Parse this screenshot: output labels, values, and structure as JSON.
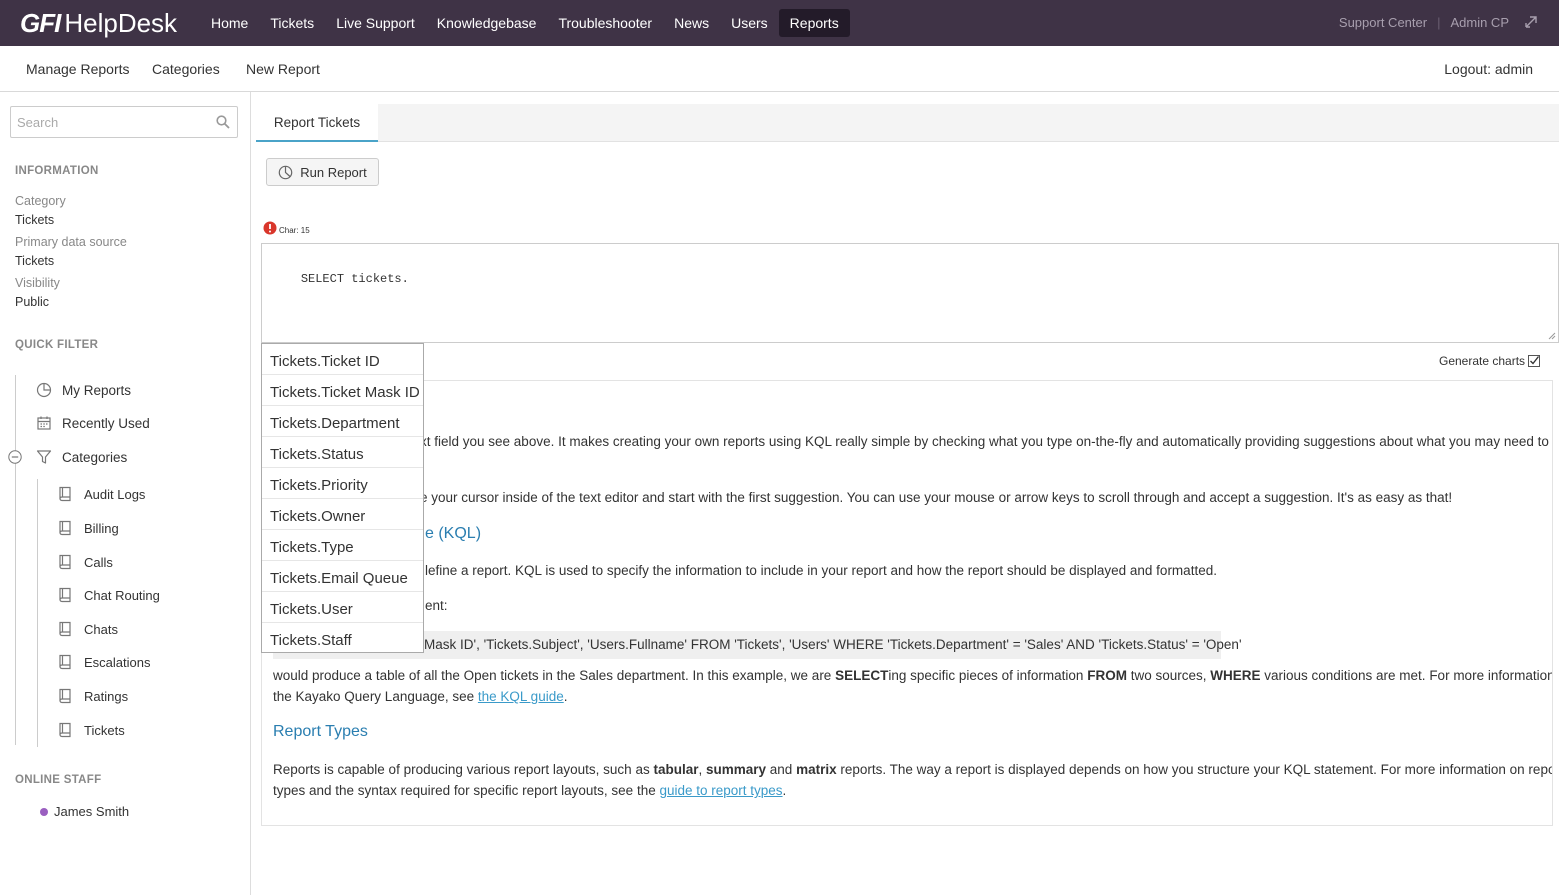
{
  "topbar": {
    "logo_brand": "GFI",
    "logo_product": "HelpDesk",
    "nav": [
      "Home",
      "Tickets",
      "Live Support",
      "Knowledgebase",
      "Troubleshooter",
      "News",
      "Users",
      "Reports"
    ],
    "active_nav": "Reports",
    "links": {
      "support_center": "Support Center",
      "admin_cp": "Admin CP"
    }
  },
  "subnav": {
    "items": [
      "Manage Reports",
      "Categories",
      "New Report"
    ],
    "logout": "Logout: admin"
  },
  "sidebar": {
    "search_placeholder": "Search",
    "information_heading": "INFORMATION",
    "info": [
      {
        "label": "Category",
        "value": "Tickets"
      },
      {
        "label": "Primary data source",
        "value": "Tickets"
      },
      {
        "label": "Visibility",
        "value": "Public"
      }
    ],
    "quick_filter_heading": "QUICK FILTER",
    "quick_filters": [
      "My Reports",
      "Recently Used",
      "Categories"
    ],
    "categories": [
      "Audit Logs",
      "Billing",
      "Calls",
      "Chat Routing",
      "Chats",
      "Escalations",
      "Ratings",
      "Tickets"
    ],
    "online_staff_heading": "ONLINE STAFF",
    "staff": [
      {
        "name": "James Smith",
        "status_color": "#9a5fc0"
      }
    ]
  },
  "main": {
    "tab": "Report Tickets",
    "run_report": "Run Report",
    "char_info": "Char: 15",
    "editor_value": "SELECT tickets.",
    "generate_charts": "Generate charts",
    "generate_charts_checked": true,
    "help": {
      "p1_visible": "xt field you see above. It makes creating your own reports using KQL really simple by checking what you type on-the-fly and automatically providing suggestions about what you may need to",
      "p2_visible": "e your cursor inside of the text editor and start with the first suggestion. You can use your mouse or arrow keys to scroll through and accept a suggestion. It's as easy as that!",
      "heading1_visible": "e (KQL)",
      "p3_visible": "lefine a report. KQL is used to specify the information to include in your report and how the report should be displayed and formatted.",
      "p4_visible": "ent:",
      "example_visible": "Mask ID', 'Tickets.Subject', 'Users.Fullname' FROM 'Tickets', 'Users' WHERE 'Tickets.Department' = 'Sales' AND 'Tickets.Status' = 'Open'",
      "p5_a": "would produce a table of all the Open tickets in the Sales department. In this example, we are ",
      "p5_b": "SELECT",
      "p5_c": "ing specific pieces of information ",
      "p5_d": "FROM",
      "p5_e": " two sources, ",
      "p5_f": "WHERE",
      "p5_g": " various conditions are met. For more information on",
      "p5_line2": "the Kayako Query Language, see ",
      "p5_link": "the KQL guide",
      "heading2": "Report Types",
      "p6_a": "Reports is capable of producing various report layouts, such as ",
      "p6_b": "tabular",
      "p6_c": ", ",
      "p6_d": "summary",
      "p6_e": " and ",
      "p6_f": "matrix",
      "p6_g": " reports. The way a report is displayed depends on how you structure your KQL statement. For more information on report",
      "p6_line2": "types and the syntax required for specific report layouts, see the ",
      "p6_link": "guide to report types",
      "period": "."
    },
    "autocomplete": [
      "Tickets.Ticket ID",
      "Tickets.Ticket Mask ID",
      "Tickets.Department",
      "Tickets.Status",
      "Tickets.Priority",
      "Tickets.Owner",
      "Tickets.Type",
      "Tickets.Email Queue",
      "Tickets.User",
      "Tickets.Staff"
    ]
  }
}
